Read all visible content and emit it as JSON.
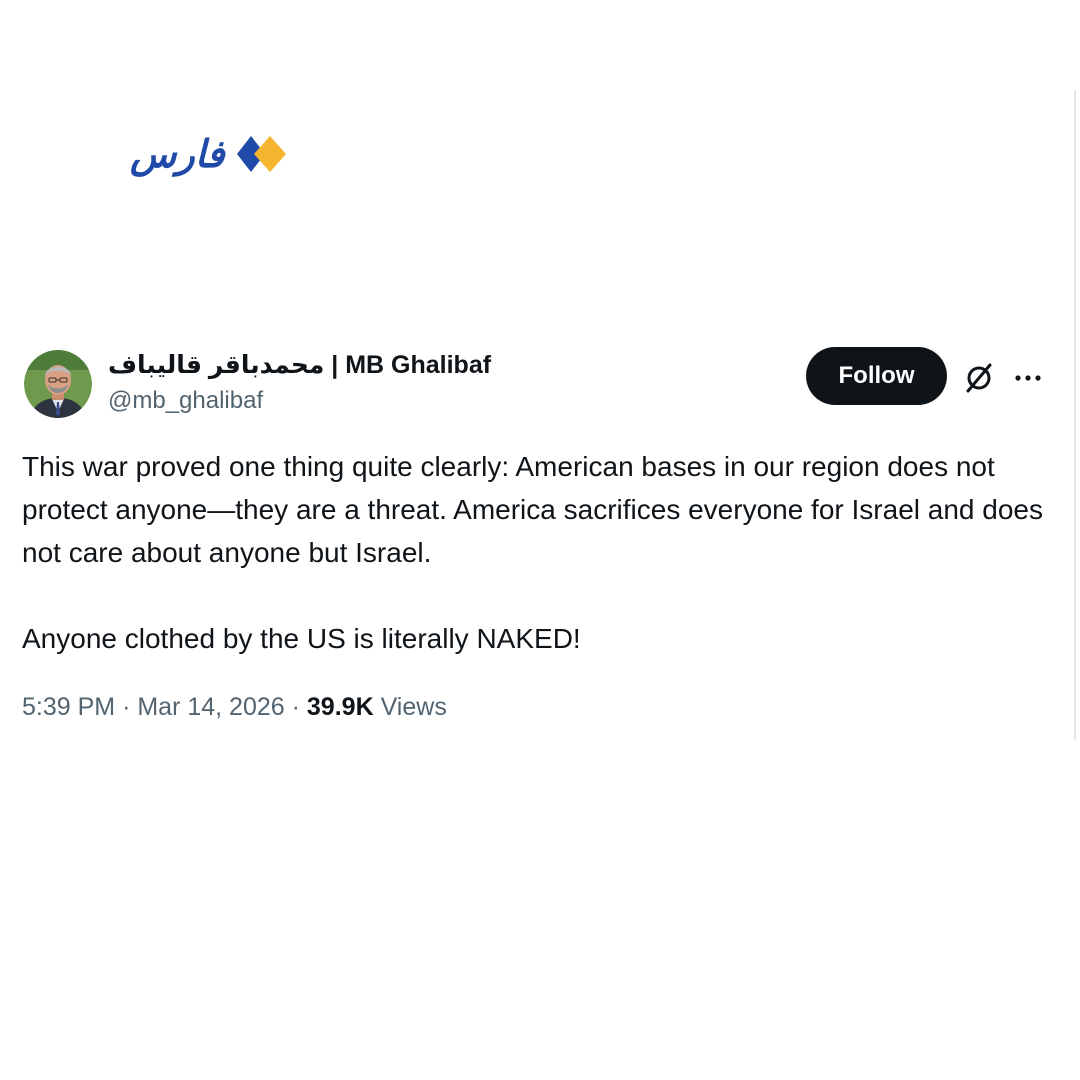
{
  "logo": {
    "text": "فارس",
    "brand_colors": {
      "word": "#1f4aa8",
      "left_diamond": "#1f4aa8",
      "right_diamond": "#f5b52e"
    }
  },
  "tweet": {
    "author": {
      "display_name": "محمدباقر قالیباف | MB Ghalibaf",
      "handle": "@mb_ghalibaf",
      "avatar_icon": "avatar-photo"
    },
    "actions": {
      "follow_label": "Follow",
      "grok_icon": "grok-icon",
      "more_icon": "more-options-icon"
    },
    "text": {
      "paragraph_1": "This war proved one thing quite clearly: American bases in our region does not protect anyone—they are a threat. America sacrifices everyone for Israel and does not care about anyone but Israel.",
      "paragraph_2": "Anyone clothed by the US is literally NAKED!"
    },
    "meta": {
      "time": "5:39 PM",
      "separator": "·",
      "date": "Mar 14, 2026",
      "views_count": "39.9K",
      "views_label": "Views"
    }
  },
  "colors": {
    "text_primary": "#0f1419",
    "text_secondary": "#536471",
    "button_bg": "#0f1419",
    "button_text": "#ffffff",
    "background": "#ffffff"
  }
}
